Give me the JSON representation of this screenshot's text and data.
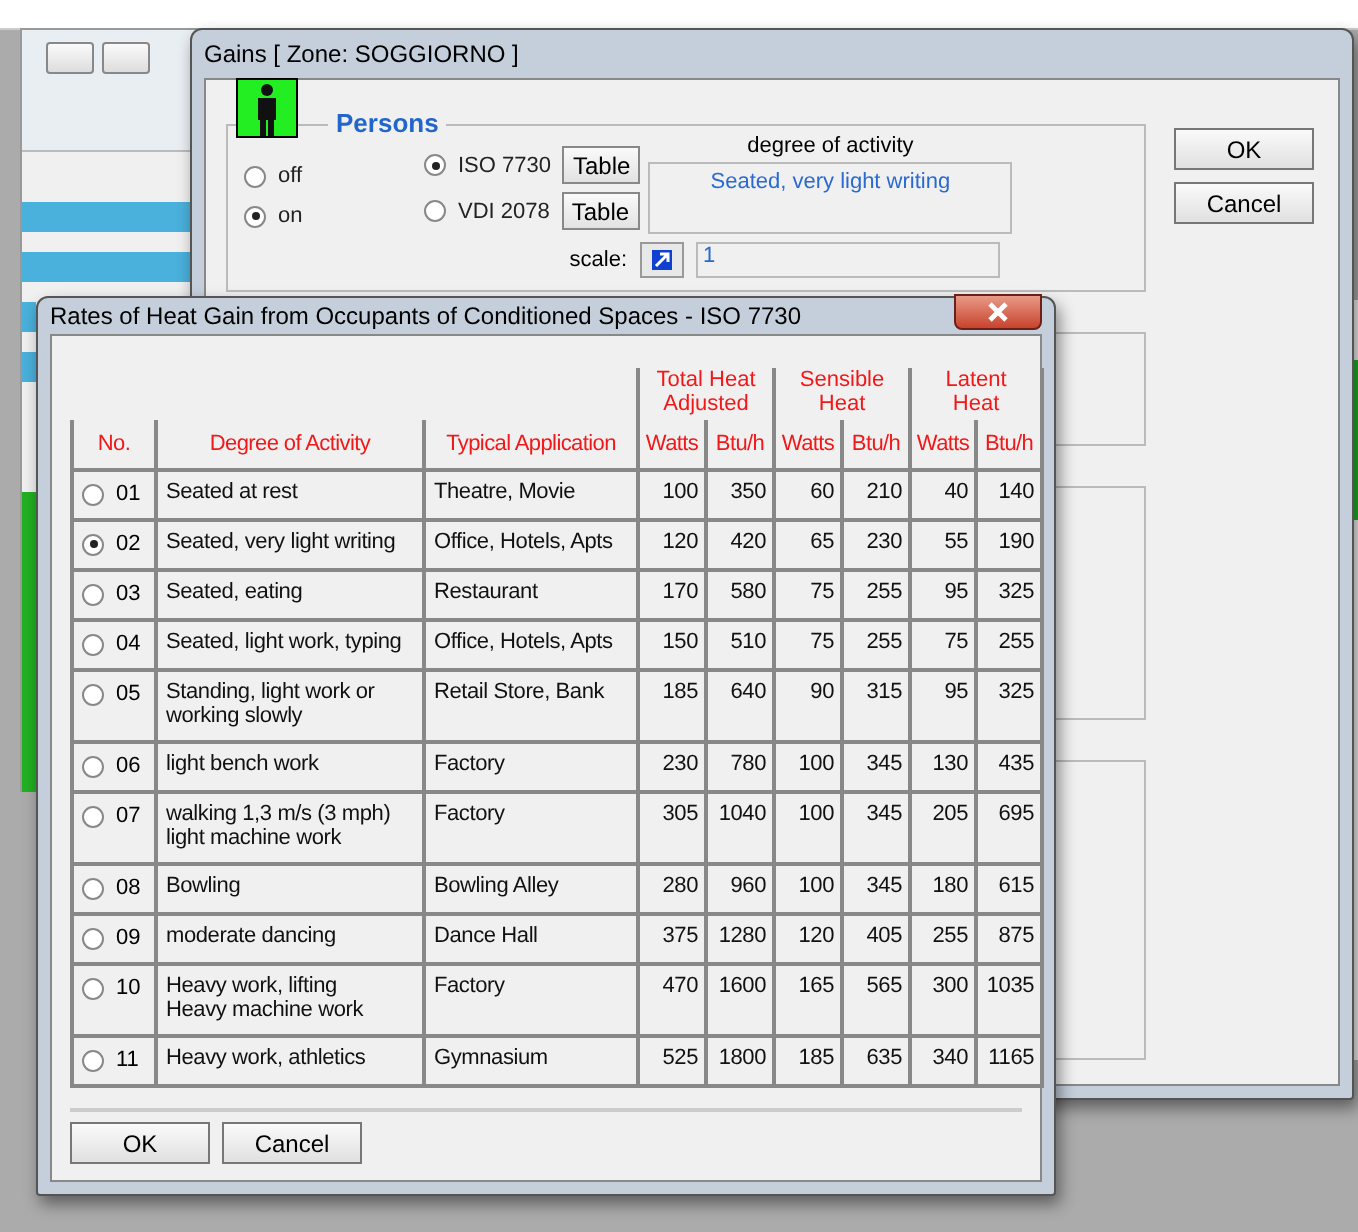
{
  "gains_dialog": {
    "title": "Gains [ Zone: SOGGIORNO ]",
    "persons": {
      "title": "Persons",
      "power": [
        {
          "label": "off",
          "selected": false
        },
        {
          "label": "on",
          "selected": true
        }
      ],
      "standards": [
        {
          "label": "ISO 7730",
          "selected": true,
          "button": "Table"
        },
        {
          "label": "VDI 2078",
          "selected": false,
          "button": "Table"
        }
      ],
      "activity_label": "degree of activity",
      "activity_value": "Seated, very light writing",
      "scale_label": "scale:",
      "scale_value": "1"
    },
    "buttons": [
      "OK",
      "Cancel"
    ]
  },
  "table_dialog": {
    "title": "Rates of Heat Gain from Occupants of Conditioned Spaces - ISO 7730",
    "group_headers": [
      "Total Heat\nAdjusted",
      "Sensible\nHeat",
      "Latent\nHeat"
    ],
    "columns": [
      "No.",
      "Degree of Activity",
      "Typical Application",
      "Watts",
      "Btu/h",
      "Watts",
      "Btu/h",
      "Watts",
      "Btu/h"
    ],
    "rows": [
      {
        "no": "01",
        "selected": false,
        "activity": "Seated at rest",
        "application": "Theatre, Movie",
        "values": [
          "100",
          "350",
          "60",
          "210",
          "40",
          "140"
        ]
      },
      {
        "no": "02",
        "selected": true,
        "activity": "Seated, very light writing",
        "application": "Office, Hotels, Apts",
        "values": [
          "120",
          "420",
          "65",
          "230",
          "55",
          "190"
        ]
      },
      {
        "no": "03",
        "selected": false,
        "activity": "Seated, eating",
        "application": "Restaurant",
        "values": [
          "170",
          "580",
          "75",
          "255",
          "95",
          "325"
        ]
      },
      {
        "no": "04",
        "selected": false,
        "activity": "Seated, light work, typing",
        "application": "Office, Hotels, Apts",
        "values": [
          "150",
          "510",
          "75",
          "255",
          "75",
          "255"
        ]
      },
      {
        "no": "05",
        "selected": false,
        "activity": "Standing, light work or\nworking slowly",
        "application": "Retail Store, Bank",
        "values": [
          "185",
          "640",
          "90",
          "315",
          "95",
          "325"
        ]
      },
      {
        "no": "06",
        "selected": false,
        "activity": "light bench work",
        "application": "Factory",
        "values": [
          "230",
          "780",
          "100",
          "345",
          "130",
          "435"
        ]
      },
      {
        "no": "07",
        "selected": false,
        "activity": "walking 1,3 m/s (3 mph)\nlight machine work",
        "application": "Factory",
        "values": [
          "305",
          "1040",
          "100",
          "345",
          "205",
          "695"
        ]
      },
      {
        "no": "08",
        "selected": false,
        "activity": "Bowling",
        "application": "Bowling Alley",
        "values": [
          "280",
          "960",
          "100",
          "345",
          "180",
          "615"
        ]
      },
      {
        "no": "09",
        "selected": false,
        "activity": "moderate dancing",
        "application": "Dance Hall",
        "values": [
          "375",
          "1280",
          "120",
          "405",
          "255",
          "875"
        ]
      },
      {
        "no": "10",
        "selected": false,
        "activity": "Heavy work, lifting\nHeavy machine work",
        "application": "Factory",
        "values": [
          "470",
          "1600",
          "165",
          "565",
          "300",
          "1035"
        ]
      },
      {
        "no": "11",
        "selected": false,
        "activity": "Heavy work, athletics",
        "application": "Gymnasium",
        "values": [
          "525",
          "1800",
          "185",
          "635",
          "340",
          "1165"
        ]
      }
    ],
    "buttons": [
      "OK",
      "Cancel"
    ]
  }
}
